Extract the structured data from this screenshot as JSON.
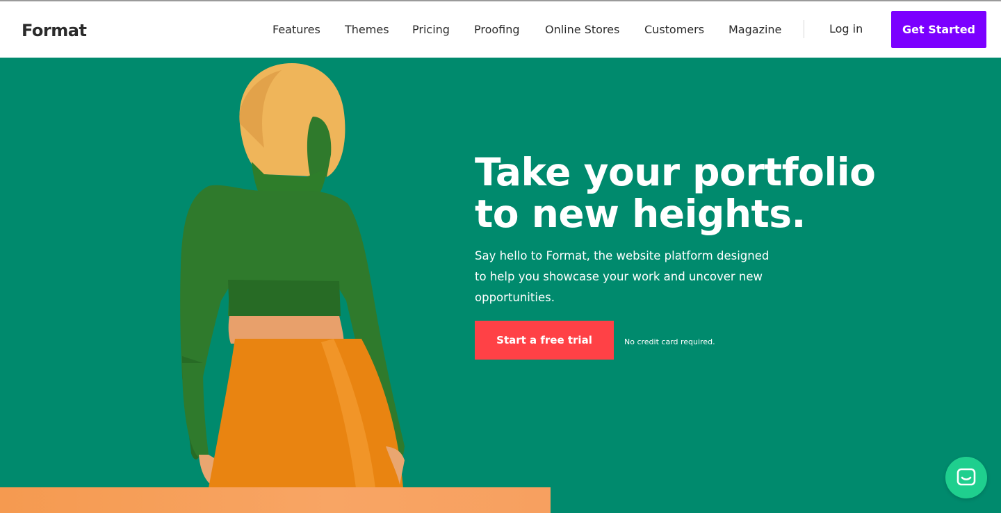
{
  "brand": {
    "logo_text": "Format"
  },
  "nav": {
    "items": [
      {
        "label": "Features"
      },
      {
        "label": "Themes"
      },
      {
        "label": "Pricing"
      },
      {
        "label": "Proofing"
      },
      {
        "label": "Online Stores"
      },
      {
        "label": "Customers"
      },
      {
        "label": "Magazine"
      }
    ],
    "login_label": "Log in",
    "get_started_label": "Get Started"
  },
  "hero": {
    "headline_line1": "Take your portfolio",
    "headline_line2": "to new heights.",
    "subtext": "Say hello to Format, the website platform designed to help you showcase your work and uncover new opportunities.",
    "cta_label": "Start a free trial",
    "note": "No credit card required."
  },
  "chat": {
    "icon": "chat-icon"
  },
  "colors": {
    "hero_bg": "#008a6d",
    "cta_top": "#7b00ff",
    "cta_trial": "#ff4146",
    "chat": "#1fcf8e",
    "orange_bar": "#f59a50"
  }
}
